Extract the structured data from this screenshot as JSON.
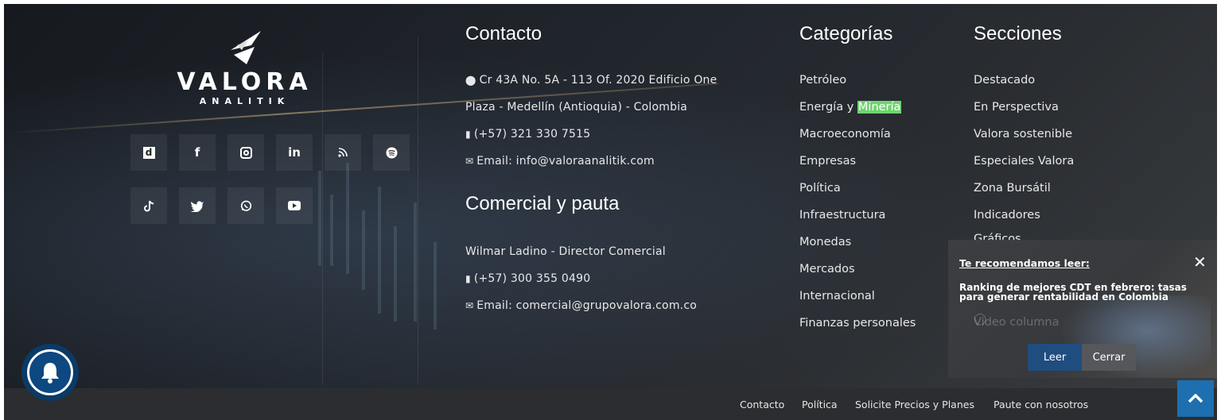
{
  "logo": {
    "brand": "VALORA",
    "sub": "ANALITIK"
  },
  "social": [
    {
      "name": "dinero-icon",
      "glyph": "d"
    },
    {
      "name": "facebook-icon",
      "glyph": "f"
    },
    {
      "name": "instagram-icon",
      "glyph": "◎"
    },
    {
      "name": "linkedin-icon",
      "glyph": "in"
    },
    {
      "name": "rss-icon",
      "glyph": "⋰"
    },
    {
      "name": "spotify-icon",
      "glyph": "≡"
    },
    {
      "name": "tiktok-icon",
      "glyph": "♪"
    },
    {
      "name": "twitter-icon",
      "glyph": "🐦"
    },
    {
      "name": "whatsapp-icon",
      "glyph": "✆"
    },
    {
      "name": "youtube-icon",
      "glyph": "▶"
    }
  ],
  "contacto": {
    "title": "Contacto",
    "address1": "Cr 43A No. 5A - 113 Of. 2020 Edificio One",
    "address2": "Plaza - Medellín (Antioquia) - Colombia",
    "phone": "(+57) 321 330 7515",
    "email": "Email: info@valoraanalitik.com"
  },
  "comercial": {
    "title": "Comercial y pauta",
    "name": "Wilmar Ladino - Director Comercial",
    "phone": "(+57) 300 355 0490",
    "email": "Email: comercial@grupovalora.com.co"
  },
  "categorias": {
    "title": "Categorías",
    "items": [
      "Petróleo",
      "Energía y ",
      "Macroeconomía",
      "Empresas",
      "Política",
      "Infraestructura",
      "Monedas",
      "Mercados",
      "Internacional",
      "Finanzas personales"
    ],
    "highlight": "Minería"
  },
  "secciones": {
    "title": "Secciones",
    "items": [
      "Destacado",
      "En Perspectiva",
      "Valora sostenible",
      "Especiales Valora",
      "Zona Bursátil",
      "Indicadores",
      "Gráficos"
    ],
    "hidden_item": "Video columna"
  },
  "bottom": {
    "links": [
      "Contacto",
      "Política",
      "Solicite Precios y Planes",
      "Paute con nosotros"
    ]
  },
  "recommend": {
    "title": "Te recomendamos leer:",
    "headline": "Ranking de mejores CDT en febrero: tasas para generar rentabilidad en Colombia",
    "read": "Leer",
    "close": "Cerrar"
  },
  "colors": {
    "highlight": "#6fd36f",
    "accent": "#1d6fb0",
    "bell": "#0d4880"
  }
}
